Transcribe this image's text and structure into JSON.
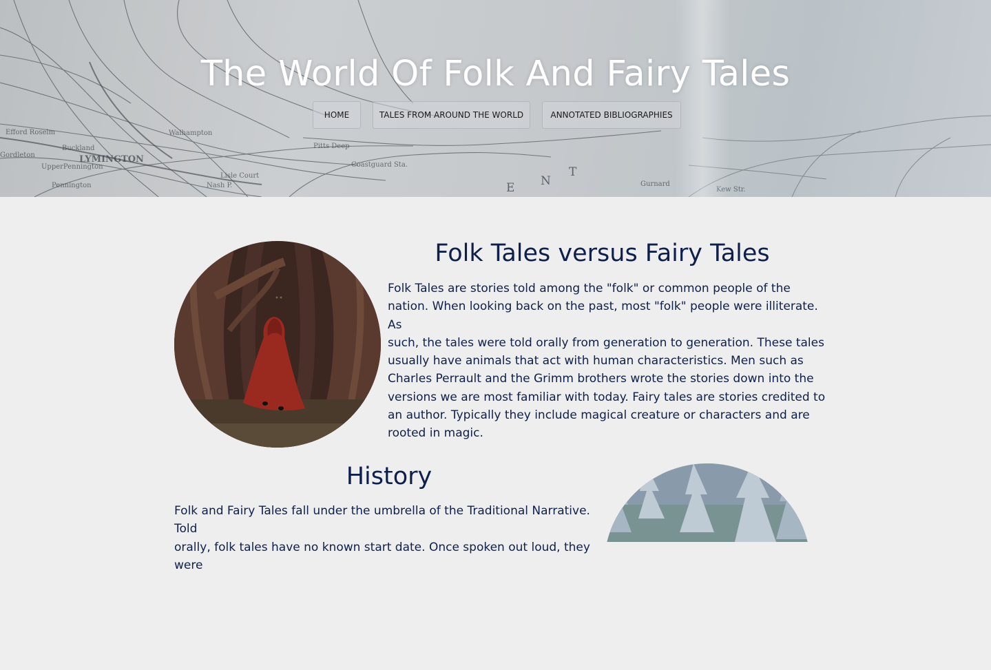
{
  "hero": {
    "title": "The World Of Folk And Fairy Tales",
    "background": "map-photo"
  },
  "nav": {
    "items": [
      {
        "label": "HOME"
      },
      {
        "label": "TALES FROM AROUND THE WORLD"
      },
      {
        "label": "ANNOTATED BIBLIOGRAPHIES"
      }
    ]
  },
  "sections": [
    {
      "heading": "Folk Tales versus Fairy Tales",
      "lines": [
        "Folk Tales are stories told among the \"folk\" or common people of the",
        "nation. When looking back on the past, most \"folk\" people were illiterate. As",
        "such, the tales were told orally from generation to generation. These tales",
        "usually have animals that act with human characteristics. Men such as",
        "Charles Perrault and the Grimm brothers wrote the stories down into the",
        "versions we are most familiar with today. Fairy tales are stories credited to",
        "an author. Typically they include magical creature or characters and are",
        "rooted in magic."
      ],
      "image": "red-riding-hood-forest-image"
    },
    {
      "heading": "History",
      "lines": [
        "Folk and Fairy Tales fall under the umbrella of the Traditional Narrative. Told",
        "orally, folk tales have no known start date. Once spoken out loud, they were"
      ],
      "image": "snowy-pine-forest-image"
    }
  ],
  "colors": {
    "page_bg": "#eeeeee",
    "text_navy": "#0e1f4a",
    "hero_title": "#ffffff"
  }
}
